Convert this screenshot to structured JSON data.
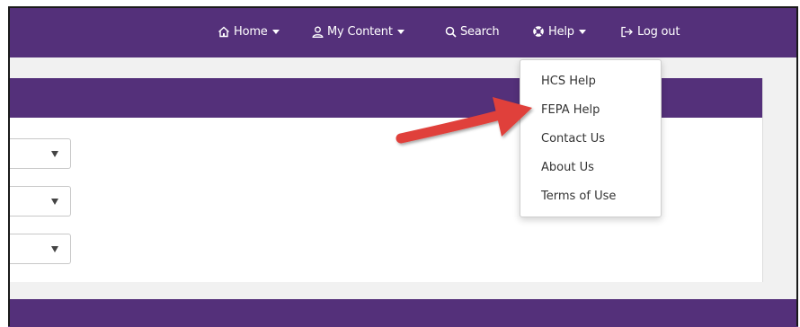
{
  "navbar": {
    "home": {
      "label": "Home",
      "icon": "home-icon"
    },
    "my_content": {
      "label": "My Content",
      "icon": "user-icon"
    },
    "search": {
      "label": "Search",
      "icon": "search-icon"
    },
    "help": {
      "label": "Help",
      "icon": "lifebuoy-icon"
    },
    "logout": {
      "label": "Log out",
      "icon": "logout-icon"
    }
  },
  "help_menu": {
    "items": [
      {
        "label": "HCS Help"
      },
      {
        "label": "FEPA Help"
      },
      {
        "label": "Contact Us"
      },
      {
        "label": "About Us"
      },
      {
        "label": "Terms of Use"
      }
    ]
  },
  "form": {
    "selects": [
      {
        "value": ""
      },
      {
        "value": ""
      },
      {
        "value": ""
      }
    ]
  },
  "annotation": {
    "pointer": "red-arrow",
    "target": "FEPA Help"
  },
  "colors": {
    "brand_purple": "#54307a",
    "annotation_red": "#e0403a",
    "content_background": "#f1f1f1"
  }
}
